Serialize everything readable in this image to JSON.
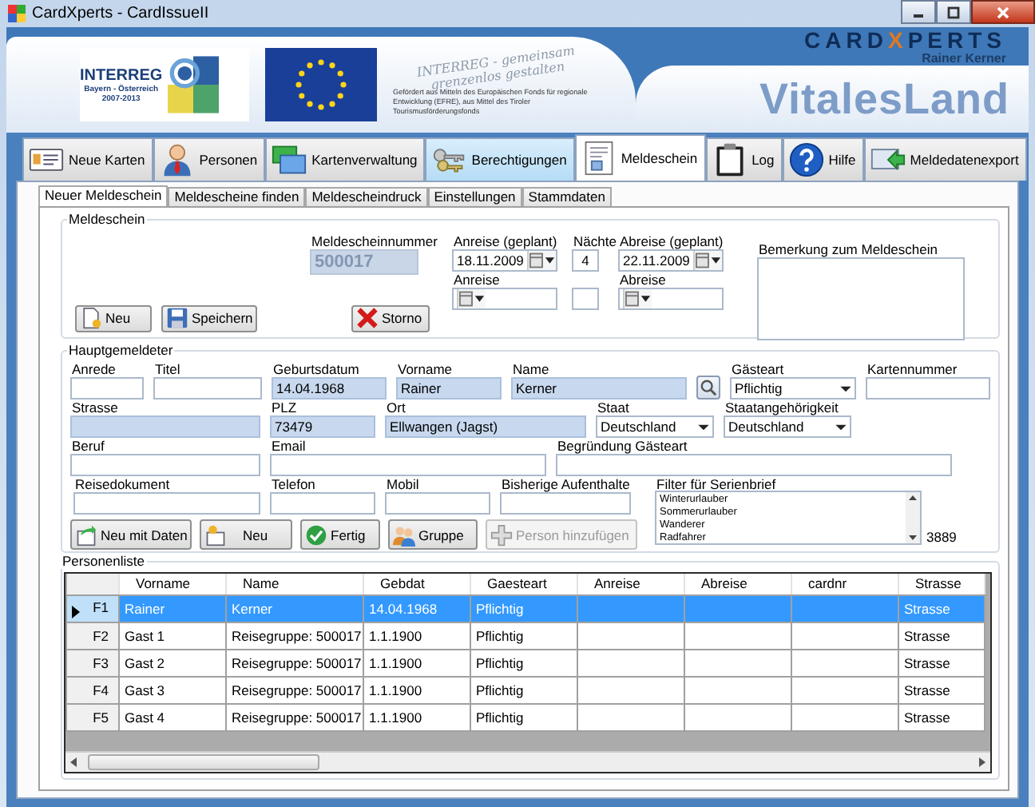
{
  "window": {
    "title": "CardXperts - CardIssueII"
  },
  "banner": {
    "program_logo": {
      "name": "INTERREG",
      "region": "Bayern - Österreich",
      "period": "2007-2013"
    },
    "slogan": [
      "INTERREG - gemeinsam",
      "grenzenlos gestalten"
    ],
    "funding_note": "Gefördert aus Mitteln des Europäischen Fonds für regionale Entwicklung (EFRE), aus Mittel des Tiroler Tourismusförderungsfonds",
    "brand": {
      "prefix": "CARD",
      "accent": "X",
      "suffix": "PERTS",
      "owner": "Rainer Kerner"
    },
    "product": "VitalesLand"
  },
  "tabs": [
    {
      "label": "Neue Karten",
      "kind": "card",
      "selected": false,
      "hovered": false
    },
    {
      "label": "Personen",
      "kind": "person",
      "selected": false,
      "hovered": false
    },
    {
      "label": "Kartenverwaltung",
      "kind": "cards",
      "selected": false,
      "hovered": false
    },
    {
      "label": "Berechtigungen",
      "kind": "keys",
      "selected": false,
      "hovered": true
    },
    {
      "label": "Meldeschein",
      "kind": "form",
      "selected": true,
      "hovered": false
    },
    {
      "label": "Log",
      "kind": "clipboard",
      "selected": false,
      "hovered": false
    },
    {
      "label": "Hilfe",
      "kind": "help",
      "selected": false,
      "hovered": false
    },
    {
      "label": "Meldedatenexport",
      "kind": "export",
      "selected": false,
      "hovered": false
    }
  ],
  "subtabs": [
    {
      "label": "Neuer Meldeschein",
      "selected": true
    },
    {
      "label": "Meldescheine finden",
      "selected": false
    },
    {
      "label": "Meldescheindruck",
      "selected": false
    },
    {
      "label": "Einstellungen",
      "selected": false
    },
    {
      "label": "Stammdaten",
      "selected": false
    }
  ],
  "meldeschein": {
    "title": "Meldeschein",
    "number": {
      "label": "Meldescheinnummer",
      "value": "500017",
      "disabled": true
    },
    "columns": [
      [
        {
          "label": "Anreise (geplant)",
          "kind": "date",
          "value": "18.11.2009"
        },
        {
          "label": "Anreise",
          "kind": "date"
        }
      ],
      [
        {
          "label": "Nächte",
          "kind": "text",
          "value": "4"
        },
        {
          "kind": "text"
        }
      ],
      [
        {
          "label": "Abreise (geplant)",
          "kind": "date",
          "value": "22.11.2009"
        },
        {
          "label": "Abreise",
          "kind": "date"
        }
      ]
    ],
    "remark": {
      "label": "Bemerkung zum Meldeschein"
    },
    "buttons": [
      {
        "label": "Neu",
        "kind": "new"
      },
      {
        "label": "Speichern",
        "kind": "save"
      },
      {
        "label": "Storno",
        "kind": "cancel"
      }
    ]
  },
  "hauptgemeldeter": {
    "title": "Hauptgemeldeter",
    "rows": [
      {
        "fields": [
          {
            "label": "Anrede",
            "kind": "text",
            "highlighted": false
          },
          {
            "label": "Titel",
            "kind": "text",
            "highlighted": false
          },
          {
            "label": "Geburtsdatum",
            "kind": "text",
            "value": "14.04.1968",
            "highlighted": true
          },
          {
            "label": "Vorname",
            "kind": "text",
            "value": "Rainer",
            "highlighted": true
          },
          {
            "label": "Name",
            "kind": "text",
            "value": "Kerner",
            "highlighted": true
          },
          {
            "kind": "search"
          },
          {
            "label": "Gästeart",
            "kind": "combo",
            "value": "Pflichtig",
            "highlighted": false
          },
          {
            "label": "Kartennummer",
            "kind": "text",
            "highlighted": false
          }
        ]
      },
      {
        "fields": [
          {
            "label": "Strasse",
            "kind": "text",
            "highlighted": true
          },
          {
            "label": "PLZ",
            "kind": "text",
            "value": "73479",
            "highlighted": true
          },
          {
            "label": "Ort",
            "kind": "text",
            "value": "Ellwangen (Jagst)",
            "highlighted": true
          },
          {
            "label": "Staat",
            "kind": "combo",
            "value": "Deutschland",
            "highlighted": false
          },
          {
            "label": "Staatangehörigkeit",
            "kind": "combo",
            "value": "Deutschland",
            "highlighted": false
          }
        ]
      },
      {
        "fields": [
          {
            "label": "Beruf",
            "kind": "text",
            "highlighted": false
          },
          {
            "label": "Email",
            "kind": "text",
            "highlighted": false
          },
          {
            "label": "Begründung Gästeart",
            "kind": "text",
            "highlighted": false
          }
        ]
      },
      {
        "fields": [
          {
            "label": "Reisedokument",
            "kind": "text",
            "highlighted": false
          },
          {
            "label": "Telefon",
            "kind": "text",
            "highlighted": false
          },
          {
            "label": "Mobil",
            "kind": "text",
            "highlighted": false
          },
          {
            "label": "Bisherige Aufenthalte",
            "kind": "text",
            "highlighted": false
          }
        ]
      }
    ],
    "filter": {
      "label": "Filter für Serienbrief",
      "items": [
        "Winterurlauber",
        "Sommerurlauber",
        "Wanderer",
        "Radfahrer"
      ],
      "count": "3889"
    },
    "buttons": [
      {
        "label": "Neu mit Daten",
        "kind": "copy",
        "disabled": false
      },
      {
        "label": "Neu",
        "kind": "newperson",
        "disabled": false
      },
      {
        "label": "Fertig",
        "kind": "done",
        "disabled": false
      },
      {
        "label": "Gruppe",
        "kind": "group",
        "disabled": false
      },
      {
        "label": "Person hinzufügen",
        "kind": "add",
        "disabled": true
      }
    ]
  },
  "personenliste": {
    "title": "Personenliste",
    "columns": [
      "Vorname",
      "Name",
      "Gebdat",
      "Gaesteart",
      "Anreise",
      "Abreise",
      "cardnr",
      "Strasse"
    ],
    "rows": [
      {
        "header": "F1",
        "current": true,
        "selected": true,
        "cells": [
          "Rainer",
          "Kerner",
          "14.04.1968",
          "Pflichtig",
          null,
          null,
          null,
          "Strasse"
        ]
      },
      {
        "header": "F2",
        "current": false,
        "selected": false,
        "cells": [
          "Gast 1",
          "Reisegruppe: 500017",
          "1.1.1900",
          "Pflichtig",
          null,
          null,
          null,
          "Strasse"
        ]
      },
      {
        "header": "F3",
        "current": false,
        "selected": false,
        "cells": [
          "Gast 2",
          "Reisegruppe: 500017",
          "1.1.1900",
          "Pflichtig",
          null,
          null,
          null,
          "Strasse"
        ]
      },
      {
        "header": "F4",
        "current": false,
        "selected": false,
        "cells": [
          "Gast 3",
          "Reisegruppe: 500017",
          "1.1.1900",
          "Pflichtig",
          null,
          null,
          null,
          "Strasse"
        ]
      },
      {
        "header": "F5",
        "current": false,
        "selected": false,
        "cells": [
          "Gast 4",
          "Reisegruppe: 500017",
          "1.1.1900",
          "Pflichtig",
          null,
          null,
          null,
          "Strasse"
        ]
      }
    ]
  }
}
